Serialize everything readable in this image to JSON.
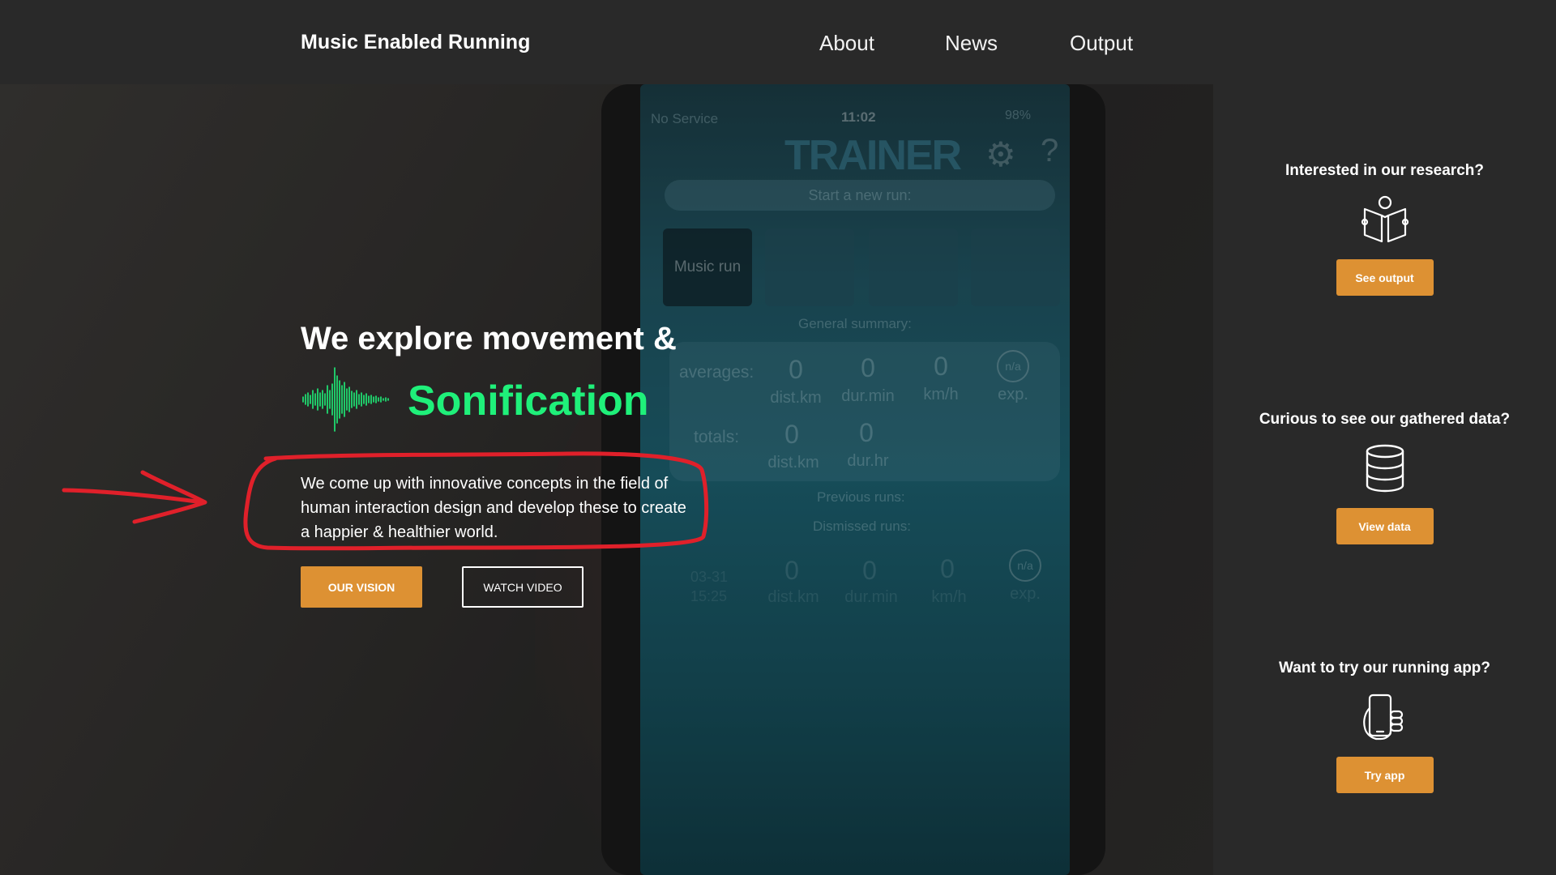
{
  "header": {
    "brand": "Music Enabled Running",
    "nav": [
      {
        "label": "About"
      },
      {
        "label": "News"
      },
      {
        "label": "Output"
      }
    ]
  },
  "hero": {
    "headline": "We explore movement &",
    "highlight": "Sonification",
    "description": "We come up with innovative concepts in the field of human interaction design and develop these to create a happier & healthier world.",
    "buttons": {
      "vision": "OUR VISION",
      "video": "WATCH VIDEO"
    },
    "phone_screen": {
      "status_left": "No Service",
      "status_time": "11:02",
      "status_right": "98%",
      "app_logo": "TRAINER",
      "new_run": "Start a new run:",
      "active_tab": "Music run",
      "summary_title": "General summary:",
      "averages_label": "averages:",
      "totals_label": "totals:",
      "averages": [
        {
          "value": "0",
          "unit": "dist.km"
        },
        {
          "value": "0",
          "unit": "dur.min"
        },
        {
          "value": "0",
          "unit": "km/h"
        },
        {
          "value": "n/a",
          "unit": "exp."
        }
      ],
      "totals": [
        {
          "value": "0",
          "unit": "dist.km"
        },
        {
          "value": "0",
          "unit": "dur.hr"
        }
      ],
      "previous_runs": "Previous runs:",
      "dismissed_runs": "Dismissed runs:",
      "run_row": {
        "date": "03-31",
        "time": "15:25",
        "values": [
          {
            "value": "0",
            "unit": "dist.km"
          },
          {
            "value": "0",
            "unit": "dur.min"
          },
          {
            "value": "0",
            "unit": "km/h"
          },
          {
            "value": "n/a",
            "unit": "exp."
          }
        ]
      }
    }
  },
  "sidebar": {
    "research": {
      "title": "Interested in our research?",
      "button": "See output",
      "icon": "open-book-icon"
    },
    "data": {
      "title": "Curious to see our gathered data?",
      "button": "View data",
      "icon": "database-icon"
    },
    "app": {
      "title": "Want to try our running app?",
      "button": "Try app",
      "icon": "phone-in-hand-icon"
    }
  },
  "colors": {
    "accent": "#dd9133",
    "highlight": "#1ff07a",
    "annotation": "#e0202a",
    "background": "#292929"
  }
}
